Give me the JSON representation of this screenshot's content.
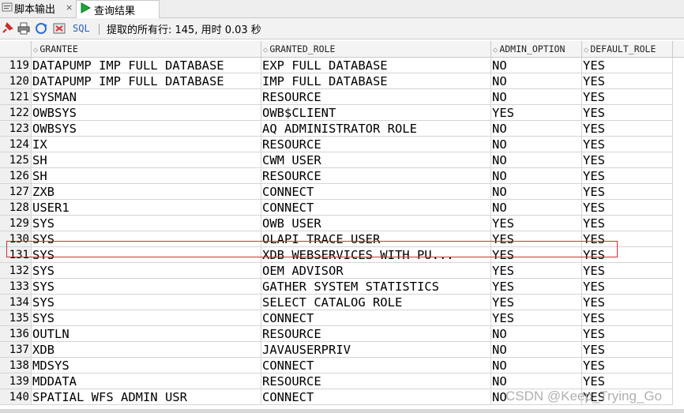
{
  "tabs": [
    {
      "label": "脚本输出",
      "close": "×"
    },
    {
      "label": "查询结果"
    }
  ],
  "toolbar": {
    "sql_label": "SQL",
    "status": "提取的所有行: 145, 用时 0.03 秒"
  },
  "columns": [
    "GRANTEE",
    "GRANTED_ROLE",
    "ADMIN_OPTION",
    "DEFAULT_ROLE"
  ],
  "rows": [
    {
      "n": "119",
      "grantee": "DATAPUMP IMP FULL DATABASE",
      "role": "EXP FULL DATABASE",
      "admin": "NO",
      "def": "YES"
    },
    {
      "n": "120",
      "grantee": "DATAPUMP IMP FULL DATABASE",
      "role": "IMP FULL DATABASE",
      "admin": "NO",
      "def": "YES"
    },
    {
      "n": "121",
      "grantee": "SYSMAN",
      "role": "RESOURCE",
      "admin": "NO",
      "def": "YES"
    },
    {
      "n": "122",
      "grantee": "OWBSYS",
      "role": "OWB$CLIENT",
      "admin": "YES",
      "def": "YES"
    },
    {
      "n": "123",
      "grantee": "OWBSYS",
      "role": "AQ ADMINISTRATOR ROLE",
      "admin": "NO",
      "def": "YES"
    },
    {
      "n": "124",
      "grantee": "IX",
      "role": "RESOURCE",
      "admin": "NO",
      "def": "YES"
    },
    {
      "n": "125",
      "grantee": "SH",
      "role": "CWM USER",
      "admin": "NO",
      "def": "YES"
    },
    {
      "n": "126",
      "grantee": "SH",
      "role": "RESOURCE",
      "admin": "NO",
      "def": "YES"
    },
    {
      "n": "127",
      "grantee": "ZXB",
      "role": "CONNECT",
      "admin": "NO",
      "def": "YES"
    },
    {
      "n": "128",
      "grantee": "USER1",
      "role": "CONNECT",
      "admin": "NO",
      "def": "YES"
    },
    {
      "n": "129",
      "grantee": "SYS",
      "role": "OWB USER",
      "admin": "YES",
      "def": "YES"
    },
    {
      "n": "130",
      "grantee": "SYS",
      "role": "OLAPI TRACE USER",
      "admin": "YES",
      "def": "YES"
    },
    {
      "n": "131",
      "grantee": "SYS",
      "role": "XDB WEBSERVICES WITH PU...",
      "admin": "YES",
      "def": "YES"
    },
    {
      "n": "132",
      "grantee": "SYS",
      "role": "OEM ADVISOR",
      "admin": "YES",
      "def": "YES"
    },
    {
      "n": "133",
      "grantee": "SYS",
      "role": "GATHER SYSTEM STATISTICS",
      "admin": "YES",
      "def": "YES"
    },
    {
      "n": "134",
      "grantee": "SYS",
      "role": "SELECT CATALOG ROLE",
      "admin": "YES",
      "def": "YES"
    },
    {
      "n": "135",
      "grantee": "SYS",
      "role": "CONNECT",
      "admin": "YES",
      "def": "YES"
    },
    {
      "n": "136",
      "grantee": "OUTLN",
      "role": "RESOURCE",
      "admin": "NO",
      "def": "YES"
    },
    {
      "n": "137",
      "grantee": "XDB",
      "role": "JAVAUSERPRIV",
      "admin": "NO",
      "def": "YES"
    },
    {
      "n": "138",
      "grantee": "MDSYS",
      "role": "CONNECT",
      "admin": "NO",
      "def": "YES"
    },
    {
      "n": "139",
      "grantee": "MDDATA",
      "role": "RESOURCE",
      "admin": "NO",
      "def": "YES"
    },
    {
      "n": "140",
      "grantee": "SPATIAL WFS ADMIN USR",
      "role": "CONNECT",
      "admin": "NO",
      "def": "YES"
    }
  ],
  "watermark": "CSDN @Keep_Trying_Go",
  "colors": {
    "highlight": "#d32f2f",
    "sql_link": "#2b5fb5"
  }
}
